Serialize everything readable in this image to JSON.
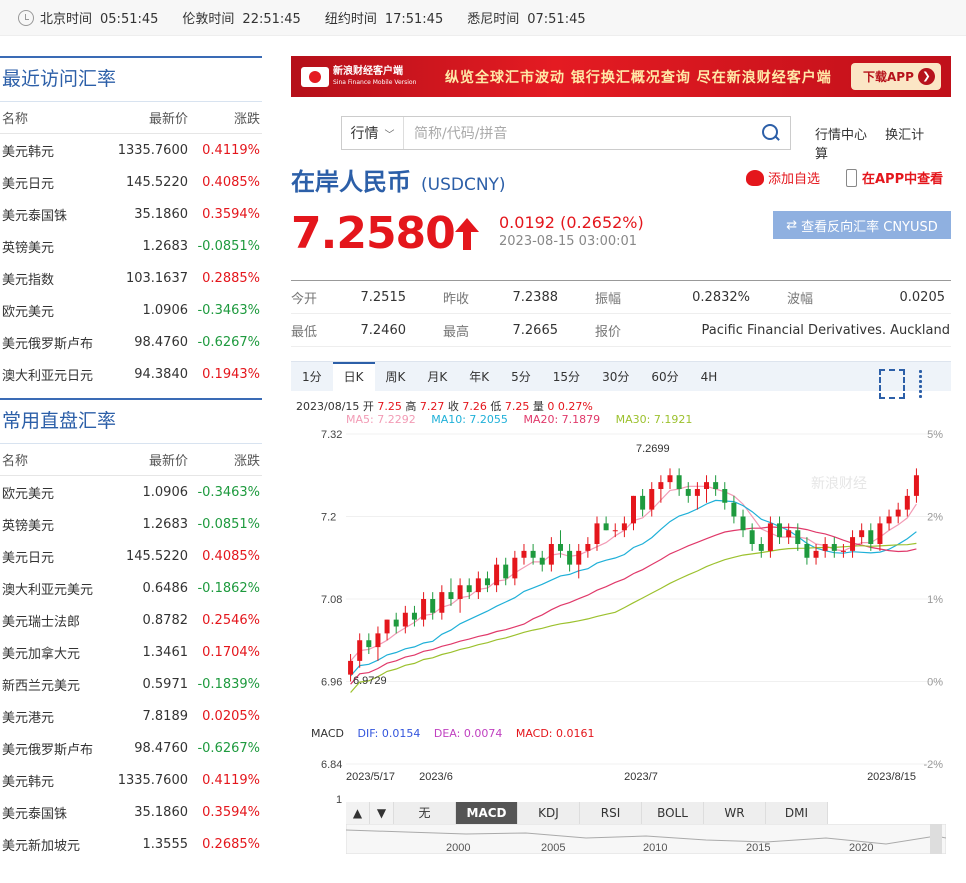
{
  "topbar": {
    "zones": [
      {
        "city": "北京时间",
        "time": "05:51:45"
      },
      {
        "city": "伦敦时间",
        "time": "22:51:45"
      },
      {
        "city": "纽约时间",
        "time": "17:51:45"
      },
      {
        "city": "悉尼时间",
        "time": "07:51:45"
      }
    ]
  },
  "recent": {
    "title": "最近访问汇率",
    "headers": [
      "名称",
      "最新价",
      "涨跌"
    ],
    "rows": [
      {
        "name": "美元韩元",
        "price": "1335.7600",
        "change": "0.4119%",
        "dir": "up"
      },
      {
        "name": "美元日元",
        "price": "145.5220",
        "change": "0.4085%",
        "dir": "up"
      },
      {
        "name": "美元泰国铢",
        "price": "35.1860",
        "change": "0.3594%",
        "dir": "up"
      },
      {
        "name": "英镑美元",
        "price": "1.2683",
        "change": "-0.0851%",
        "dir": "dn"
      },
      {
        "name": "美元指数",
        "price": "103.1637",
        "change": "0.2885%",
        "dir": "up"
      },
      {
        "name": "欧元美元",
        "price": "1.0906",
        "change": "-0.3463%",
        "dir": "dn"
      },
      {
        "name": "美元俄罗斯卢布",
        "price": "98.4760",
        "change": "-0.6267%",
        "dir": "dn"
      },
      {
        "name": "澳大利亚元日元",
        "price": "94.3840",
        "change": "0.1943%",
        "dir": "up"
      }
    ]
  },
  "common": {
    "title": "常用直盘汇率",
    "headers": [
      "名称",
      "最新价",
      "涨跌"
    ],
    "rows": [
      {
        "name": "欧元美元",
        "price": "1.0906",
        "change": "-0.3463%",
        "dir": "dn"
      },
      {
        "name": "英镑美元",
        "price": "1.2683",
        "change": "-0.0851%",
        "dir": "dn"
      },
      {
        "name": "美元日元",
        "price": "145.5220",
        "change": "0.4085%",
        "dir": "up"
      },
      {
        "name": "澳大利亚元美元",
        "price": "0.6486",
        "change": "-0.1862%",
        "dir": "dn"
      },
      {
        "name": "美元瑞士法郎",
        "price": "0.8782",
        "change": "0.2546%",
        "dir": "up"
      },
      {
        "name": "美元加拿大元",
        "price": "1.3461",
        "change": "0.1704%",
        "dir": "up"
      },
      {
        "name": "新西兰元美元",
        "price": "0.5971",
        "change": "-0.1839%",
        "dir": "dn"
      },
      {
        "name": "美元港元",
        "price": "7.8189",
        "change": "0.0205%",
        "dir": "up"
      },
      {
        "name": "美元俄罗斯卢布",
        "price": "98.4760",
        "change": "-0.6267%",
        "dir": "dn"
      },
      {
        "name": "美元韩元",
        "price": "1335.7600",
        "change": "0.4119%",
        "dir": "up"
      },
      {
        "name": "美元泰国铢",
        "price": "35.1860",
        "change": "0.3594%",
        "dir": "up"
      },
      {
        "name": "美元新加坡元",
        "price": "1.3555",
        "change": "0.2685%",
        "dir": "up"
      }
    ]
  },
  "banner": {
    "app_name": "新浪财经客户端",
    "app_sub": "Sina Finance Mobile Version",
    "slogan": "纵览全球汇市波动  银行换汇概况查询  尽在新浪财经客户端",
    "download": "下载APP"
  },
  "search": {
    "select": "行情",
    "placeholder": "简称/代码/拼音",
    "links": [
      "行情中心",
      "换汇计算"
    ]
  },
  "quote": {
    "name": "在岸人民币",
    "code": "(USDCNY)",
    "add_fav": "添加自选",
    "in_app": "在APP中查看",
    "price": "7.2580",
    "change": "0.0192 (0.2652%)",
    "time": "2023-08-15 03:00:01",
    "reverse": "查看反向汇率 CNYUSD"
  },
  "stats": [
    [
      {
        "label": "今开",
        "value": "7.2515"
      },
      {
        "label": "昨收",
        "value": "7.2388"
      },
      {
        "label": "振幅",
        "value": "0.2832%"
      },
      {
        "label": "波幅",
        "value": "0.0205"
      }
    ],
    [
      {
        "label": "最低",
        "value": "7.2460"
      },
      {
        "label": "最高",
        "value": "7.2665"
      },
      {
        "label": "报价",
        "value": "Pacific Financial Derivatives. Auckland"
      }
    ]
  ],
  "tabs": [
    "1分",
    "日K",
    "周K",
    "月K",
    "年K",
    "5分",
    "15分",
    "30分",
    "60分",
    "4H"
  ],
  "active_tab": "日K",
  "ohlc_line": {
    "date": "2023/08/15",
    "open_l": "开",
    "open": "7.25",
    "high_l": "高",
    "high": "7.27",
    "close_l": "收",
    "close": "7.26",
    "low_l": "低",
    "low": "7.25",
    "vol_l": "量",
    "vol": "0",
    "pct": "0.27%"
  },
  "ma": [
    {
      "label": "MA5: 7.2292",
      "color": "#f29bb5"
    },
    {
      "label": "MA10: 7.2055",
      "color": "#1fb0d8"
    },
    {
      "label": "MA20: 7.1879",
      "color": "#e0396a"
    },
    {
      "label": "MA30: 7.1921",
      "color": "#9cc12e"
    }
  ],
  "macd": {
    "label": "MACD",
    "dif": "DIF: 0.0154",
    "dea": "DEA: 0.0074",
    "macd": "MACD: 0.0161"
  },
  "indicator_tabs": [
    "无",
    "MACD",
    "KDJ",
    "RSI",
    "BOLL",
    "WR",
    "DMI"
  ],
  "active_indicator": "MACD",
  "nav_buttons": [
    "▲",
    "▼"
  ],
  "chart_data": {
    "type": "candlestick",
    "y_ticks": [
      "7.32",
      "7.2",
      "7.08",
      "6.96",
      "6.84"
    ],
    "pct_ticks": [
      "5%",
      "2%",
      "1%",
      "0%",
      "-2%"
    ],
    "x_ticks": [
      "2023/5/17",
      "2023/6",
      "2023/7",
      "2023/8/15"
    ],
    "annotations": {
      "high": "7.2699",
      "low": "6.9729"
    },
    "watermark": "新浪财经",
    "ylim": [
      6.84,
      7.32
    ],
    "candles": [
      [
        6.97,
        7.0,
        6.96,
        6.99
      ],
      [
        6.99,
        7.03,
        6.98,
        7.02
      ],
      [
        7.02,
        7.03,
        7.0,
        7.01
      ],
      [
        7.01,
        7.04,
        6.99,
        7.03
      ],
      [
        7.03,
        7.05,
        7.02,
        7.05
      ],
      [
        7.05,
        7.06,
        7.03,
        7.04
      ],
      [
        7.04,
        7.07,
        7.03,
        7.06
      ],
      [
        7.06,
        7.07,
        7.04,
        7.05
      ],
      [
        7.05,
        7.09,
        7.04,
        7.08
      ],
      [
        7.08,
        7.09,
        7.05,
        7.06
      ],
      [
        7.06,
        7.1,
        7.05,
        7.09
      ],
      [
        7.09,
        7.11,
        7.07,
        7.08
      ],
      [
        7.08,
        7.11,
        7.06,
        7.1
      ],
      [
        7.1,
        7.11,
        7.08,
        7.09
      ],
      [
        7.09,
        7.12,
        7.08,
        7.11
      ],
      [
        7.11,
        7.12,
        7.09,
        7.1
      ],
      [
        7.1,
        7.14,
        7.09,
        7.13
      ],
      [
        7.13,
        7.14,
        7.1,
        7.11
      ],
      [
        7.11,
        7.15,
        7.1,
        7.14
      ],
      [
        7.14,
        7.16,
        7.13,
        7.15
      ],
      [
        7.15,
        7.16,
        7.13,
        7.14
      ],
      [
        7.14,
        7.15,
        7.12,
        7.13
      ],
      [
        7.13,
        7.17,
        7.12,
        7.16
      ],
      [
        7.16,
        7.18,
        7.14,
        7.15
      ],
      [
        7.15,
        7.16,
        7.12,
        7.13
      ],
      [
        7.13,
        7.16,
        7.11,
        7.15
      ],
      [
        7.15,
        7.17,
        7.14,
        7.16
      ],
      [
        7.16,
        7.2,
        7.15,
        7.19
      ],
      [
        7.19,
        7.2,
        7.18,
        7.18
      ],
      [
        7.18,
        7.19,
        7.17,
        7.18
      ],
      [
        7.18,
        7.2,
        7.17,
        7.19
      ],
      [
        7.19,
        7.23,
        7.18,
        7.23
      ],
      [
        7.23,
        7.24,
        7.2,
        7.21
      ],
      [
        7.21,
        7.25,
        7.2,
        7.24
      ],
      [
        7.24,
        7.26,
        7.22,
        7.25
      ],
      [
        7.25,
        7.27,
        7.24,
        7.26
      ],
      [
        7.26,
        7.27,
        7.23,
        7.24
      ],
      [
        7.24,
        7.25,
        7.22,
        7.23
      ],
      [
        7.23,
        7.25,
        7.21,
        7.24
      ],
      [
        7.24,
        7.26,
        7.22,
        7.25
      ],
      [
        7.25,
        7.26,
        7.23,
        7.24
      ],
      [
        7.24,
        7.25,
        7.21,
        7.22
      ],
      [
        7.22,
        7.23,
        7.19,
        7.2
      ],
      [
        7.2,
        7.21,
        7.17,
        7.18
      ],
      [
        7.18,
        7.19,
        7.15,
        7.16
      ],
      [
        7.16,
        7.17,
        7.14,
        7.15
      ],
      [
        7.15,
        7.2,
        7.14,
        7.19
      ],
      [
        7.19,
        7.2,
        7.16,
        7.17
      ],
      [
        7.17,
        7.19,
        7.16,
        7.18
      ],
      [
        7.18,
        7.19,
        7.15,
        7.16
      ],
      [
        7.16,
        7.17,
        7.13,
        7.14
      ],
      [
        7.14,
        7.16,
        7.13,
        7.15
      ],
      [
        7.15,
        7.17,
        7.14,
        7.16
      ],
      [
        7.16,
        7.17,
        7.14,
        7.15
      ],
      [
        7.15,
        7.16,
        7.14,
        7.15
      ],
      [
        7.15,
        7.18,
        7.14,
        7.17
      ],
      [
        7.17,
        7.19,
        7.16,
        7.18
      ],
      [
        7.18,
        7.19,
        7.15,
        7.16
      ],
      [
        7.16,
        7.2,
        7.15,
        7.19
      ],
      [
        7.19,
        7.21,
        7.18,
        7.2
      ],
      [
        7.2,
        7.22,
        7.19,
        7.21
      ],
      [
        7.21,
        7.24,
        7.2,
        7.23
      ],
      [
        7.23,
        7.27,
        7.22,
        7.26
      ]
    ]
  }
}
